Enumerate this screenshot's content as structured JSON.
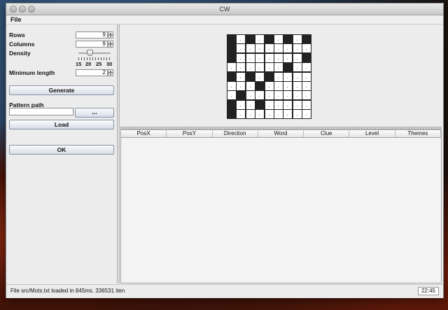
{
  "window": {
    "title": "CW"
  },
  "menu": {
    "file": "File"
  },
  "form": {
    "rows_label": "Rows",
    "rows_value": "9",
    "columns_label": "Columns",
    "columns_value": "9",
    "density_label": "Density",
    "density_ticks": [
      "15",
      "20",
      "25",
      "30"
    ],
    "min_length_label": "Minimum length",
    "min_length_value": "2",
    "generate_label": "Generate",
    "pattern_path_label": "Pattern path",
    "pattern_path_value": "",
    "browse_label": "...",
    "load_label": "Load",
    "ok_label": "OK"
  },
  "grid": {
    "size": 9,
    "black_cells": [
      [
        0,
        0
      ],
      [
        0,
        2
      ],
      [
        0,
        4
      ],
      [
        0,
        6
      ],
      [
        0,
        8
      ],
      [
        1,
        0
      ],
      [
        2,
        0
      ],
      [
        2,
        8
      ],
      [
        3,
        6
      ],
      [
        4,
        0
      ],
      [
        4,
        2
      ],
      [
        4,
        4
      ],
      [
        5,
        3
      ],
      [
        6,
        1
      ],
      [
        7,
        0
      ],
      [
        7,
        3
      ],
      [
        8,
        0
      ]
    ]
  },
  "table": {
    "columns": [
      "PosX",
      "PosY",
      "Direction",
      "Word",
      "Clue",
      "Level",
      "Themes"
    ]
  },
  "status": {
    "message": "File src/Mots.txt loaded in 845ms. 336531 iten",
    "clock": "22:45"
  }
}
